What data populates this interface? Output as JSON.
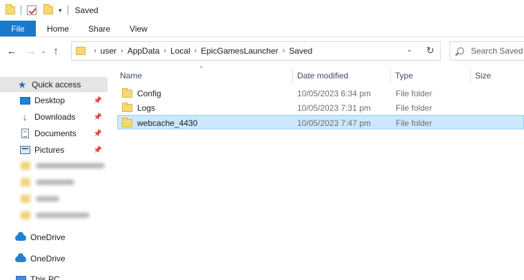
{
  "window": {
    "title": "Saved"
  },
  "ribbon": {
    "tabs": [
      "File",
      "Home",
      "Share",
      "View"
    ]
  },
  "address": {
    "crumbs": [
      "user",
      "AppData",
      "Local",
      "EpicGamesLauncher",
      "Saved"
    ]
  },
  "search": {
    "placeholder": "Search Saved"
  },
  "sidebar": {
    "quick_access": "Quick access",
    "pinned": [
      {
        "label": "Desktop",
        "icon": "desktop-icon"
      },
      {
        "label": "Downloads",
        "icon": "download-icon"
      },
      {
        "label": "Documents",
        "icon": "documents-icon"
      },
      {
        "label": "Pictures",
        "icon": "pictures-icon"
      }
    ],
    "onedrive_1": "OneDrive",
    "onedrive_2": "OneDrive",
    "this_pc": "This PC"
  },
  "columns": {
    "name": "Name",
    "date": "Date modified",
    "type": "Type",
    "size": "Size"
  },
  "files": [
    {
      "name": "Config",
      "date": "10/05/2023 6:34 pm",
      "type": "File folder",
      "selected": false
    },
    {
      "name": "Logs",
      "date": "10/05/2023 7:31 pm",
      "type": "File folder",
      "selected": false
    },
    {
      "name": "webcache_4430",
      "date": "10/05/2023 7:47 pm",
      "type": "File folder",
      "selected": true
    }
  ],
  "colors": {
    "accent": "#1979ca",
    "selection": "#cce8ff",
    "folder": "#f8d775"
  }
}
